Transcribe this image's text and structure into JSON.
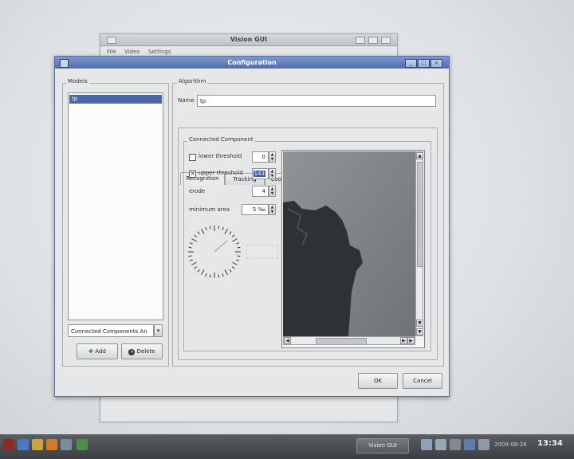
{
  "background_window": {
    "title": "Vision GUI",
    "menu": [
      "File",
      "Video",
      "Settings"
    ]
  },
  "dialog": {
    "title": "Configuration",
    "models": {
      "group_label": "Models",
      "items": [
        "tp"
      ],
      "combo_value": "Connected Components An",
      "add_label": "Add",
      "delete_label": "Delete"
    },
    "algorithm": {
      "group_label": "Algorithm",
      "name_label": "Name",
      "name_value": "tp",
      "tabs": [
        "Recognition",
        "Tracking",
        "Coordinate System"
      ],
      "active_tab": "Recognition",
      "cc_group_label": "Connected Component",
      "lower_threshold": {
        "label": "lower threshold",
        "checked": false,
        "value": "0"
      },
      "upper_threshold": {
        "label": "upper threshold",
        "checked": true,
        "value": "143"
      },
      "erode": {
        "label": "erode",
        "value": "4"
      },
      "minimum_area": {
        "label": "minimum area",
        "value": "5 ‰"
      }
    },
    "ok_label": "OK",
    "cancel_label": "Cancel"
  },
  "taskbar": {
    "active_window": "Vision GUI",
    "date": "2009-08-26",
    "time": "13:34"
  }
}
